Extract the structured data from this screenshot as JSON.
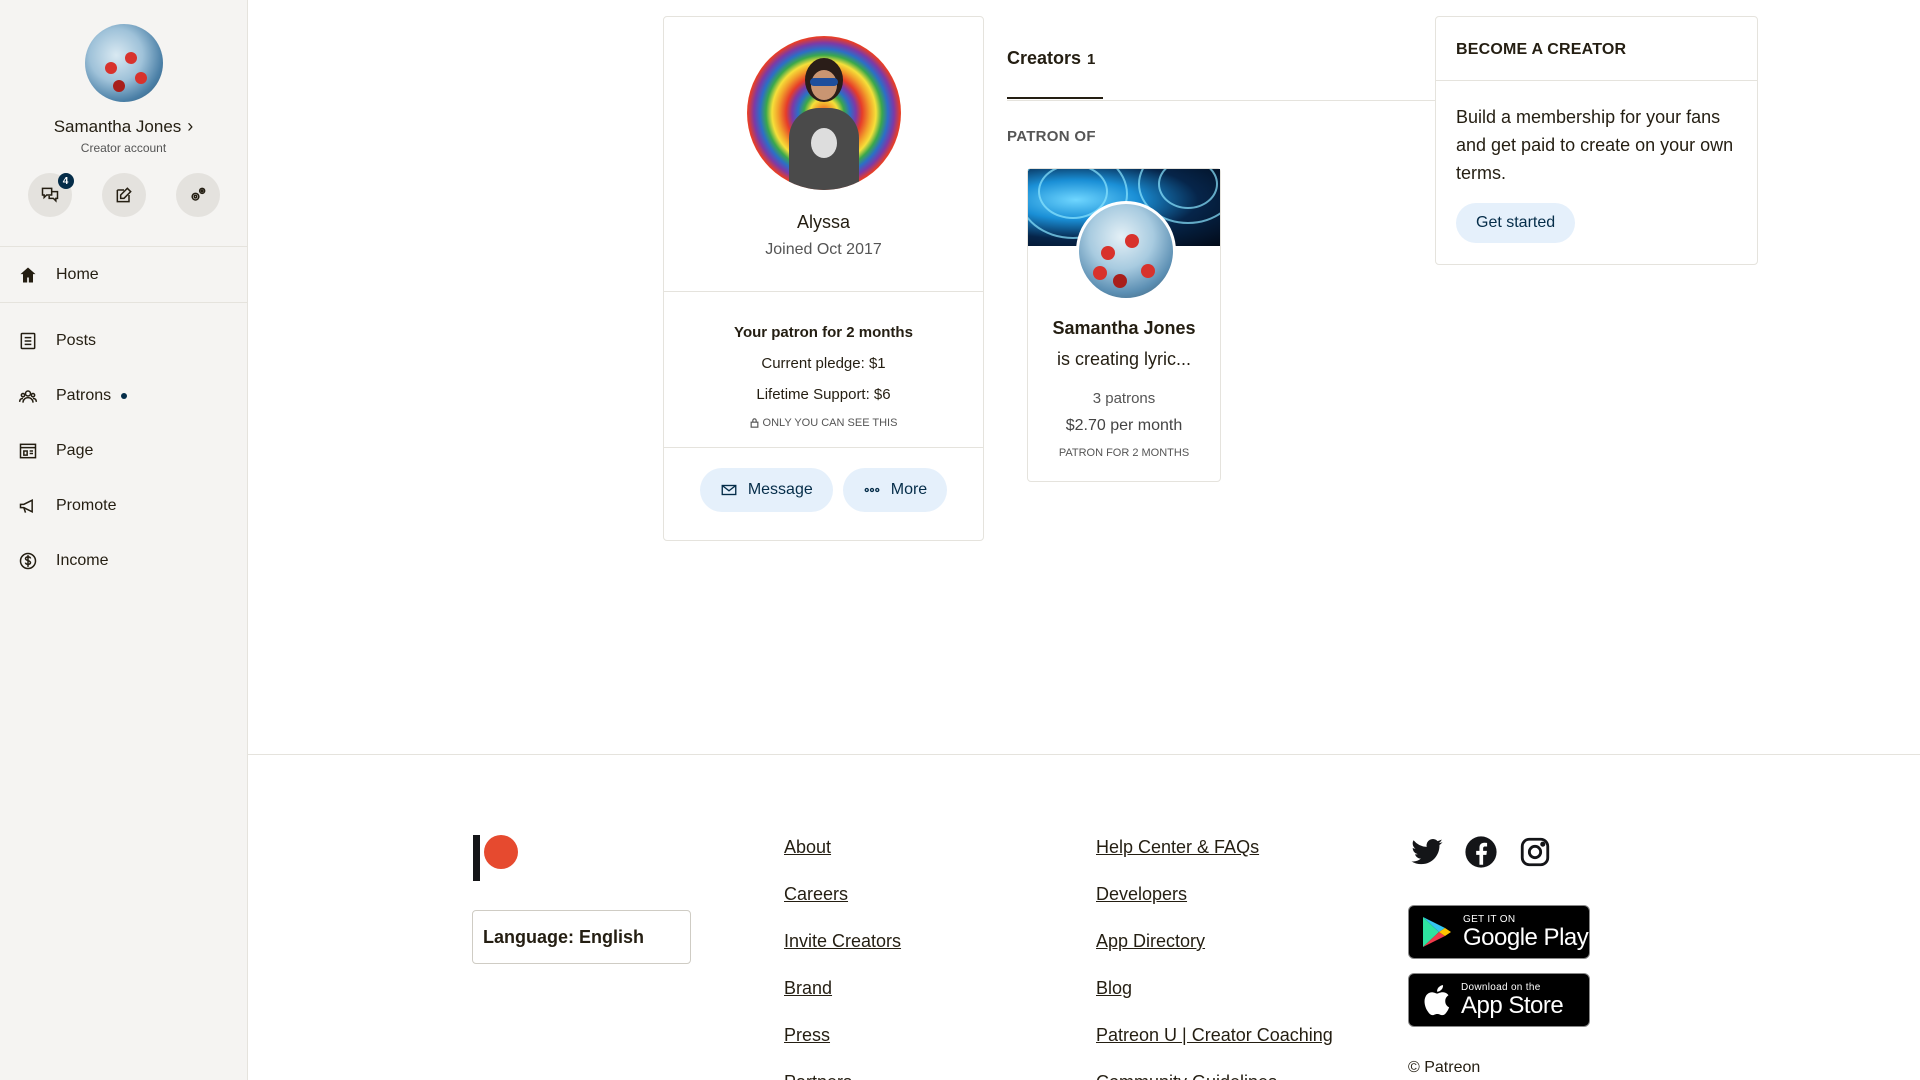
{
  "sidebar": {
    "user_name": "Samantha Jones",
    "account_type": "Creator account",
    "notifications_count": "4",
    "home_label": "Home",
    "items": [
      {
        "label": "Posts",
        "icon": "posts-icon"
      },
      {
        "label": "Patrons",
        "icon": "patrons-icon"
      },
      {
        "label": "Page",
        "icon": "page-icon"
      },
      {
        "label": "Promote",
        "icon": "megaphone-icon"
      },
      {
        "label": "Income",
        "icon": "dollar-icon"
      }
    ]
  },
  "patron_card": {
    "name": "Alyssa",
    "joined": "Joined Oct 2017",
    "duration_title": "Your patron for 2 months",
    "current_pledge": "Current pledge: $1",
    "lifetime_support": "Lifetime Support: $6",
    "privacy_note": "ONLY YOU CAN SEE THIS",
    "message_label": "Message",
    "more_label": "More"
  },
  "creators_section": {
    "tab_label": "Creators",
    "tab_count": "1",
    "section_title": "PATRON OF",
    "creator": {
      "name": "Samantha Jones",
      "description": "is creating lyric...",
      "patron_count": "3 patrons",
      "monthly": "$2.70 per month",
      "period": "PATRON FOR 2 MONTHS"
    }
  },
  "become_creator": {
    "title": "BECOME A CREATOR",
    "body": "Build a membership for your fans and get paid to create on your own terms.",
    "button_label": "Get started"
  },
  "footer": {
    "language_label": "Language: English",
    "links_col1": [
      "About",
      "Careers",
      "Invite Creators",
      "Brand",
      "Press",
      "Partners"
    ],
    "links_col2": [
      "Help Center & FAQs",
      "Developers",
      "App Directory",
      "Blog",
      "Patreon U | Creator Coaching",
      "Community Guidelines"
    ],
    "google_play_small": "GET IT ON",
    "google_play_big": "Google Play",
    "app_store_small": "Download on the",
    "app_store_big": "App Store",
    "copyright": "© Patreon"
  },
  "colors": {
    "brand_coral": "#e64a2f",
    "navy": "#052d49",
    "pill_bg": "#e5f0fb",
    "sidebar_bg": "#f5f4f2"
  }
}
